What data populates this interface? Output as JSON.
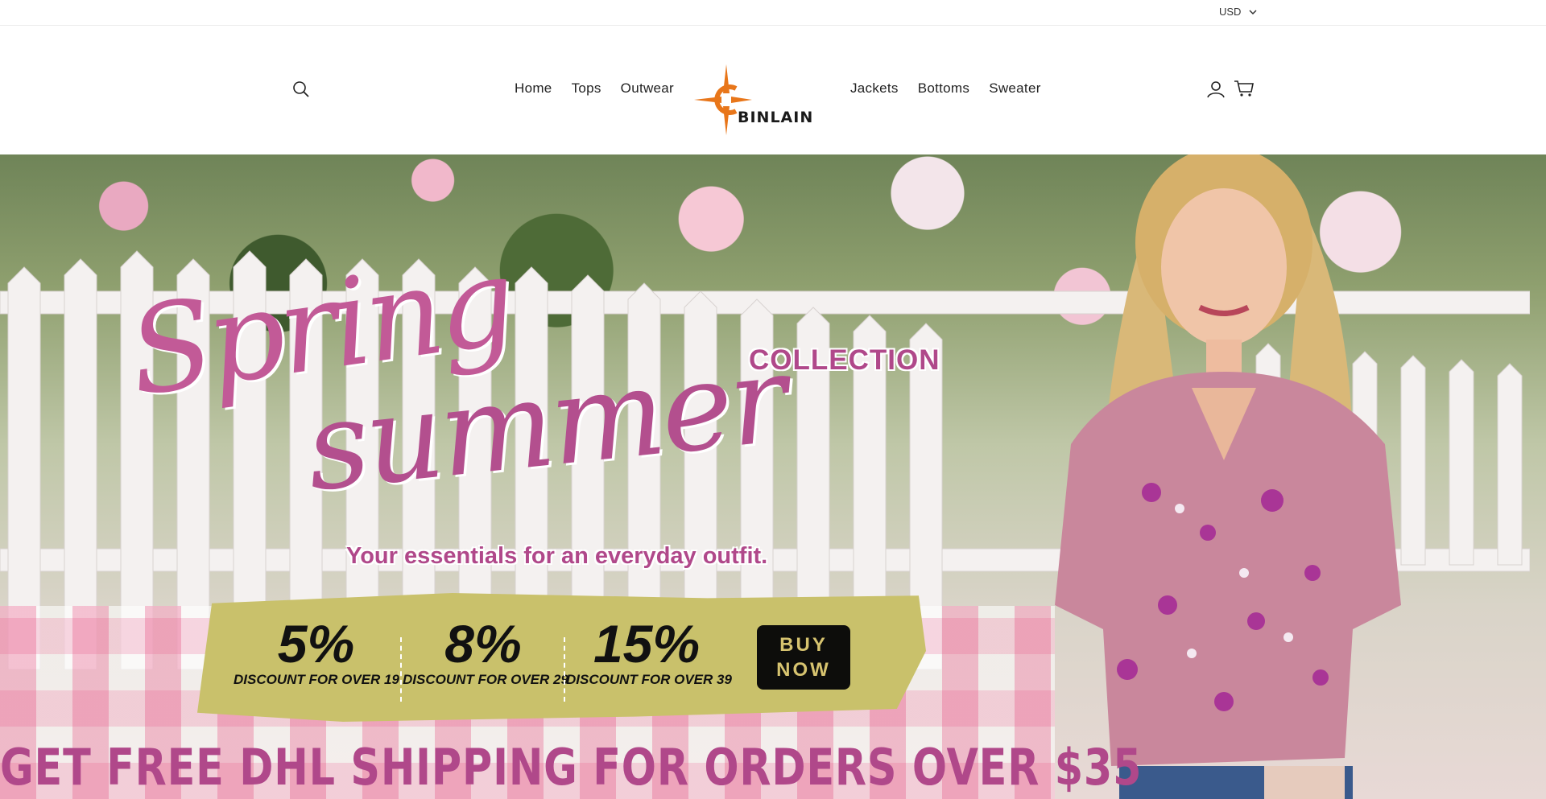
{
  "utility_bar": {
    "currency": "USD"
  },
  "header": {
    "nav_left": [
      "Home",
      "Tops",
      "Outwear"
    ],
    "nav_right": [
      "Jackets",
      "Bottoms",
      "Sweater"
    ],
    "logo_text": "BINLAIN",
    "icons": [
      "search-icon",
      "account-icon",
      "cart-icon"
    ]
  },
  "hero": {
    "script_line1": "Spring",
    "script_line2": "summer",
    "collection": "COLLECTION",
    "tagline": "Your essentials for an everyday outfit.",
    "discounts": [
      {
        "percent": "5%",
        "label": "DISCOUNT FOR OVER 19"
      },
      {
        "percent": "8%",
        "label": "DISCOUNT FOR OVER 29"
      },
      {
        "percent": "15%",
        "label": "DISCOUNT FOR OVER 39"
      }
    ],
    "buy_now": "BUY NOW",
    "shipping": "GET FREE DHL SHIPPING FOR ORDERS OVER $35"
  },
  "colors": {
    "accent": "#b0488a",
    "panel": "#c9c16b",
    "button": "#0d0d0b",
    "button_text": "#d6c36f"
  }
}
